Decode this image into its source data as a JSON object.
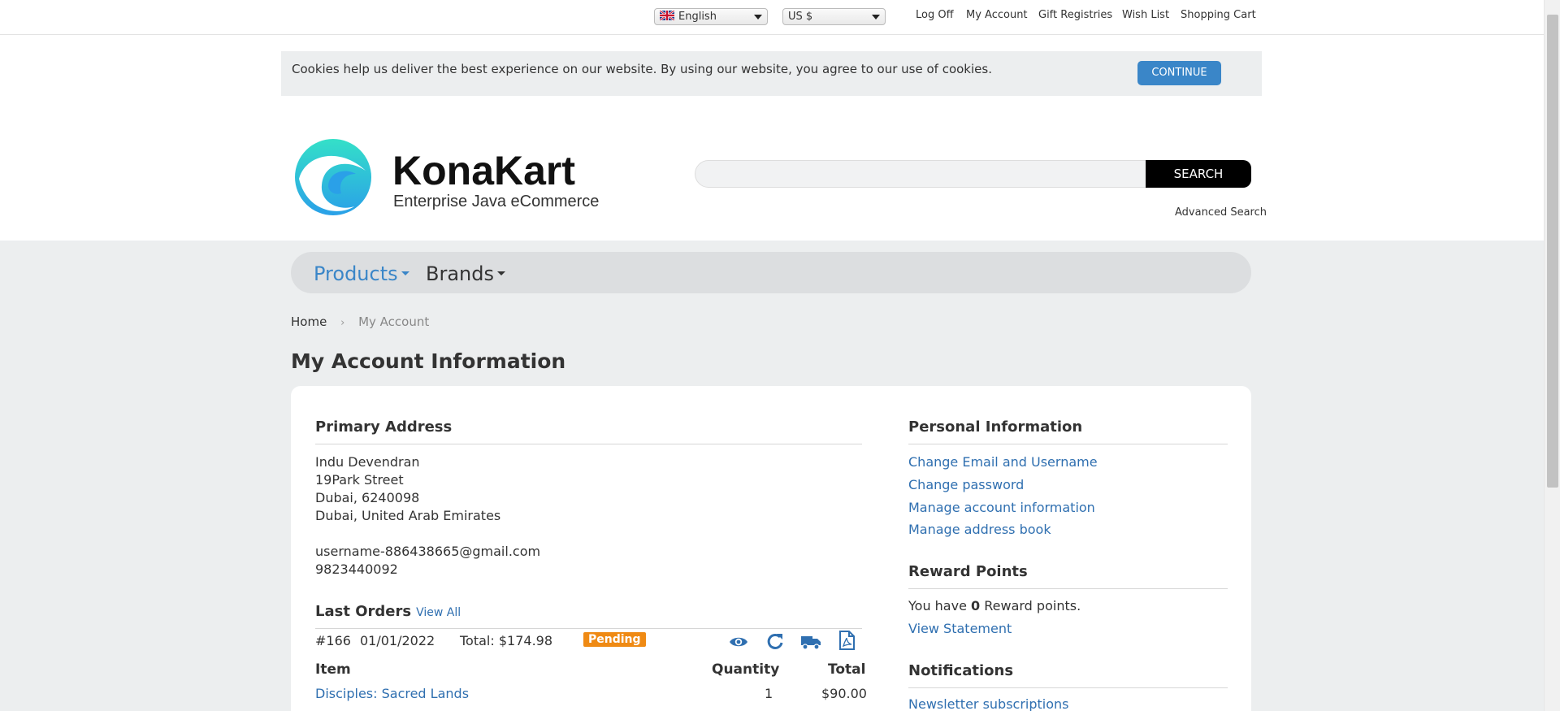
{
  "topbar": {
    "language": "English",
    "currency": "US $",
    "links": [
      "Log Off",
      "My Account",
      "Gift Registries",
      "Wish List",
      "Shopping Cart"
    ]
  },
  "cookie": {
    "message": "Cookies help us deliver the best experience on our website. By using our website, you agree to our use of cookies.",
    "button": "CONTINUE"
  },
  "header": {
    "logo_name": "KonaKart",
    "logo_tagline": "Enterprise Java eCommerce",
    "search_value": "",
    "search_button": "SEARCH",
    "advanced_search": "Advanced Search"
  },
  "nav": {
    "products": "Products",
    "brands": "Brands"
  },
  "breadcrumb": {
    "home": "Home",
    "current": "My Account"
  },
  "page": {
    "title": "My Account Information"
  },
  "primary_address": {
    "heading": "Primary Address",
    "lines": [
      "Indu Devendran",
      "19Park Street",
      "Dubai, 6240098",
      "Dubai, United Arab Emirates"
    ],
    "email": "username-886438665@gmail.com",
    "phone": "9823440092"
  },
  "last_orders": {
    "heading": "Last Orders",
    "view_all": "View All",
    "order": {
      "number": "#166",
      "date": "01/01/2022",
      "total": "Total: $174.98",
      "status": "Pending"
    },
    "columns": {
      "item": "Item",
      "quantity": "Quantity",
      "total": "Total"
    },
    "items": [
      {
        "name": "Disciples: Sacred Lands",
        "quantity": "1",
        "total": "$90.00"
      }
    ]
  },
  "personal_info": {
    "heading": "Personal Information",
    "links": [
      "Change Email and Username",
      "Change password",
      "Manage account information",
      "Manage address book"
    ]
  },
  "reward_points": {
    "heading": "Reward Points",
    "prefix": "You have",
    "points": "0",
    "suffix": "Reward points.",
    "view_statement": "View Statement"
  },
  "notifications": {
    "heading": "Notifications",
    "links": [
      "Newsletter subscriptions"
    ]
  },
  "colors": {
    "link": "#2f6fb0",
    "accent_blue": "#3a86c8",
    "pending_badge": "#ef8a14",
    "nav_active": "#3a86c8"
  }
}
